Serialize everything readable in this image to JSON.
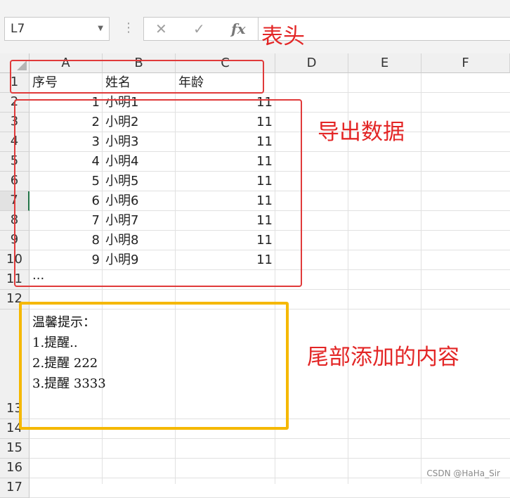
{
  "formula_bar": {
    "name_box": "L7",
    "cancel_icon": "x-icon",
    "enter_icon": "check-icon",
    "function_icon": "fx-icon",
    "function_label": "fx",
    "formula": ""
  },
  "sheet": {
    "columns": [
      "A",
      "B",
      "C",
      "D",
      "E",
      "F"
    ],
    "rows": [
      "1",
      "2",
      "3",
      "4",
      "5",
      "6",
      "7",
      "8",
      "9",
      "10",
      "11",
      "12",
      "13",
      "14",
      "15",
      "16",
      "17"
    ],
    "selected_row": "7",
    "header_row": {
      "a": "序号",
      "b": "姓名",
      "c": "年龄"
    },
    "data_rows": [
      {
        "a": "1",
        "b": "小明1",
        "c": "11"
      },
      {
        "a": "2",
        "b": "小明2",
        "c": "11"
      },
      {
        "a": "3",
        "b": "小明3",
        "c": "11"
      },
      {
        "a": "4",
        "b": "小明4",
        "c": "11"
      },
      {
        "a": "5",
        "b": "小明5",
        "c": "11"
      },
      {
        "a": "6",
        "b": "小明6",
        "c": "11"
      },
      {
        "a": "7",
        "b": "小明7",
        "c": "11"
      },
      {
        "a": "8",
        "b": "小明8",
        "c": "11"
      },
      {
        "a": "9",
        "b": "小明9",
        "c": "11"
      }
    ],
    "ellipsis_row": "...",
    "footer_notes": [
      "温馨提示：",
      "1.提醒..",
      "2.提醒 222",
      "3.提醒 3333"
    ]
  },
  "annotations": {
    "header_label": "表头",
    "data_label": "导出数据",
    "footer_label": "尾部添加的内容",
    "header_color": "#e03a3a",
    "data_color": "#e03a3a",
    "footer_color": "#f5b800"
  },
  "watermark": "CSDN @HaHa_Sir"
}
